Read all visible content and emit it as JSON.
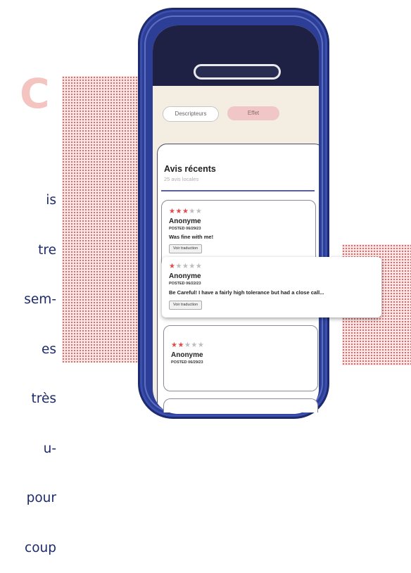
{
  "decor": {
    "letter": "C"
  },
  "side_text": [
    "is",
    "tre",
    "sem-",
    "es",
    "très",
    "u-",
    "pour",
    "coup"
  ],
  "tabs": [
    {
      "label": "Descripteurs",
      "active": false
    },
    {
      "label": "Effet",
      "active": true
    }
  ],
  "reviews_panel": {
    "title": "Avis récents",
    "subtitle": "25 avis locales"
  },
  "reviews": [
    {
      "rating": 3,
      "author": "Anonyme",
      "date": "POSTED 06/29/23",
      "text": "Was fine with me!",
      "button": "Voir traduction"
    },
    {
      "rating": 1,
      "author": "Anonyme",
      "date": "POSTED 06/22/23",
      "text": "Be Careful! I have a fairly high tolerance but had a close call...",
      "button": "Voir traduction"
    },
    {
      "rating": 2,
      "author": "Anonyme",
      "date": "POSTED 06/29/23",
      "text": "",
      "button": ""
    }
  ],
  "colors": {
    "phone": "#2d3e97",
    "screen_top": "#1f2144",
    "star_on": "#e24a4a",
    "accent_tab": "#f0c6c6"
  }
}
